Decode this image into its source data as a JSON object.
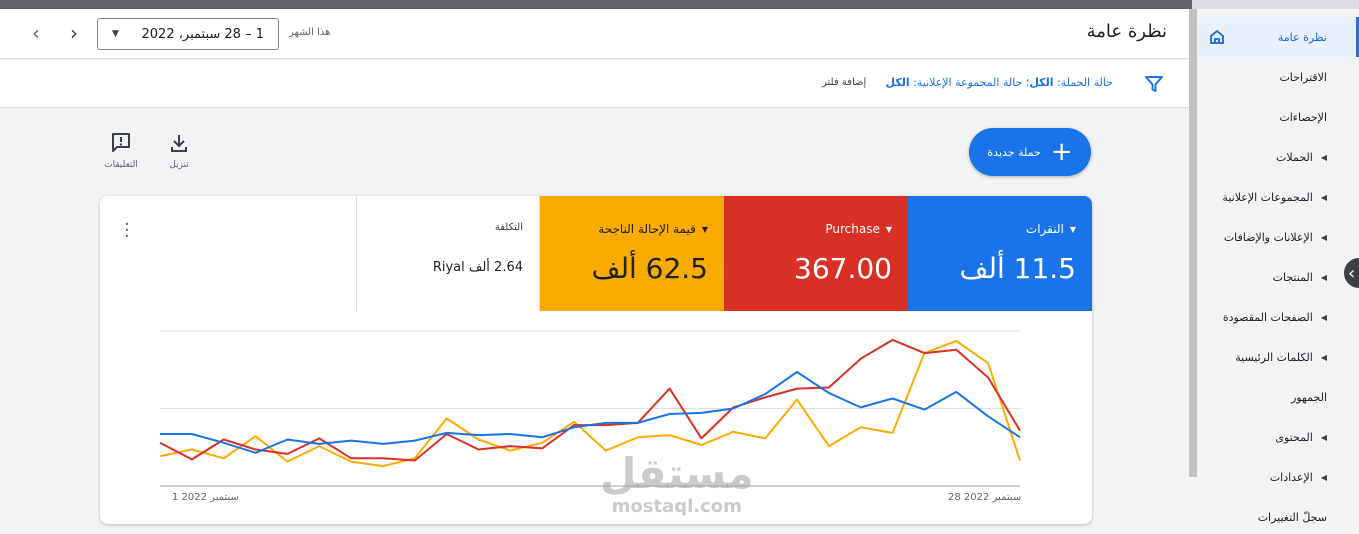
{
  "header": {
    "title": "نظرة عامة",
    "date_range": "1 – 28 سبتمبر، 2022",
    "date_preset": "هذا الشهر"
  },
  "filter": {
    "text_campaign_label": "حالة الحملة:",
    "text_campaign_value": "الكل",
    "text_adgroup_label": "؛ حالة المجموعة الإعلانية:",
    "text_adgroup_value": "الكل",
    "add_filter": "إضافة فلتر"
  },
  "actions": {
    "new_campaign": "حملة جديدة",
    "download": "تنزيل",
    "feedback": "التعليقات"
  },
  "sidebar": {
    "items": [
      {
        "label": "نظرة عامة",
        "caret": false
      },
      {
        "label": "الاقتراحات",
        "caret": false
      },
      {
        "label": "الإحصاءات",
        "caret": false
      },
      {
        "label": "الحملات",
        "caret": true
      },
      {
        "label": "المجموعات الإعلانية",
        "caret": true
      },
      {
        "label": "الإعلانات والإضافات",
        "caret": true
      },
      {
        "label": "المنتجات",
        "caret": true
      },
      {
        "label": "الصفحات المقصودة",
        "caret": true
      },
      {
        "label": "الكلمات الرئيسية",
        "caret": true
      },
      {
        "label": "الجمهور",
        "caret": false
      },
      {
        "label": "المحتوى",
        "caret": true
      },
      {
        "label": "الإعدادات",
        "caret": true
      },
      {
        "label": "سجلّ التغييرات",
        "caret": false
      }
    ]
  },
  "kpis": [
    {
      "label": "النقرات",
      "value": "11.5 ألف",
      "color": "#1a73e8",
      "dropdown": true
    },
    {
      "label": "Purchase",
      "value": "367.00",
      "color": "#d93025",
      "dropdown": true
    },
    {
      "label": "قيمة الإحالة الناجحة",
      "value": "62.5 ألف",
      "color": "#f9ab00",
      "dropdown": true
    },
    {
      "label": "التكلفة",
      "value": "2.64 ألف Riyal",
      "color": "#ffffff",
      "dropdown": false
    }
  ],
  "chart_data": {
    "type": "line",
    "x_start_label": "1 سبتمبر 2022",
    "x_end_label": "28 سبتمبر 2022",
    "x": [
      1,
      2,
      3,
      4,
      5,
      6,
      7,
      8,
      9,
      10,
      11,
      12,
      13,
      14,
      15,
      16,
      17,
      18,
      19,
      20,
      21,
      22,
      23,
      24,
      25,
      26,
      27,
      28
    ],
    "series": [
      {
        "name": "النقرات",
        "color": "#1a73e8",
        "values": [
          47,
          47,
          39,
          30,
          42,
          38,
          41,
          38,
          41,
          48,
          46,
          47,
          44,
          53,
          57,
          57,
          65,
          66,
          70,
          83,
          103,
          84,
          71,
          79,
          69,
          85,
          63,
          44
        ]
      },
      {
        "name": "Purchase",
        "color": "#d93025",
        "values": [
          39,
          24,
          42,
          33,
          29,
          43,
          25,
          25,
          23,
          47,
          33,
          36,
          34,
          55,
          55,
          57,
          88,
          43,
          71,
          80,
          88,
          89,
          115,
          132,
          120,
          123,
          98,
          50
        ]
      },
      {
        "name": "قيمة الإحالة الناجحة",
        "color": "#f9ab00",
        "values": [
          27,
          33,
          25,
          45,
          22,
          36,
          22,
          18,
          25,
          61,
          42,
          32,
          39,
          58,
          32,
          44,
          46,
          37,
          49,
          43,
          78,
          36,
          53,
          48,
          120,
          131,
          111,
          23
        ]
      },
      {
        "name": "التكلفة",
        "color": "#9aa0a6",
        "values": []
      }
    ]
  },
  "watermark": {
    "line1": "مستقل",
    "line2": "mostaql.com"
  }
}
